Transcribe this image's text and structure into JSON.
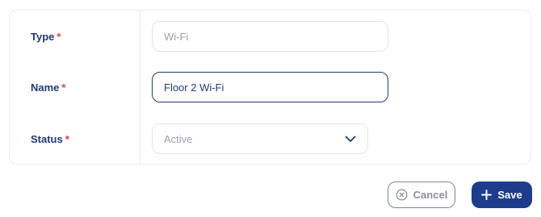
{
  "form": {
    "fields": [
      {
        "label": "Type",
        "required_mark": "*",
        "value": "Wi-Fi",
        "disabled": true
      },
      {
        "label": "Name",
        "required_mark": "*",
        "value": "Floor 2 Wi-Fi",
        "focused": true
      },
      {
        "label": "Status",
        "required_mark": "*",
        "value": "Active"
      }
    ]
  },
  "actions": {
    "cancel_label": "Cancel",
    "save_label": "Save"
  },
  "colors": {
    "label": "#1f3a7a",
    "required": "#e53935",
    "primary": "#1d3c8c",
    "border": "#dfe2e8",
    "muted_text": "#9aa0ab"
  },
  "icons": {
    "cancel": "close-circle-icon",
    "save": "plus-icon",
    "status_dropdown": "chevron-down-icon"
  }
}
